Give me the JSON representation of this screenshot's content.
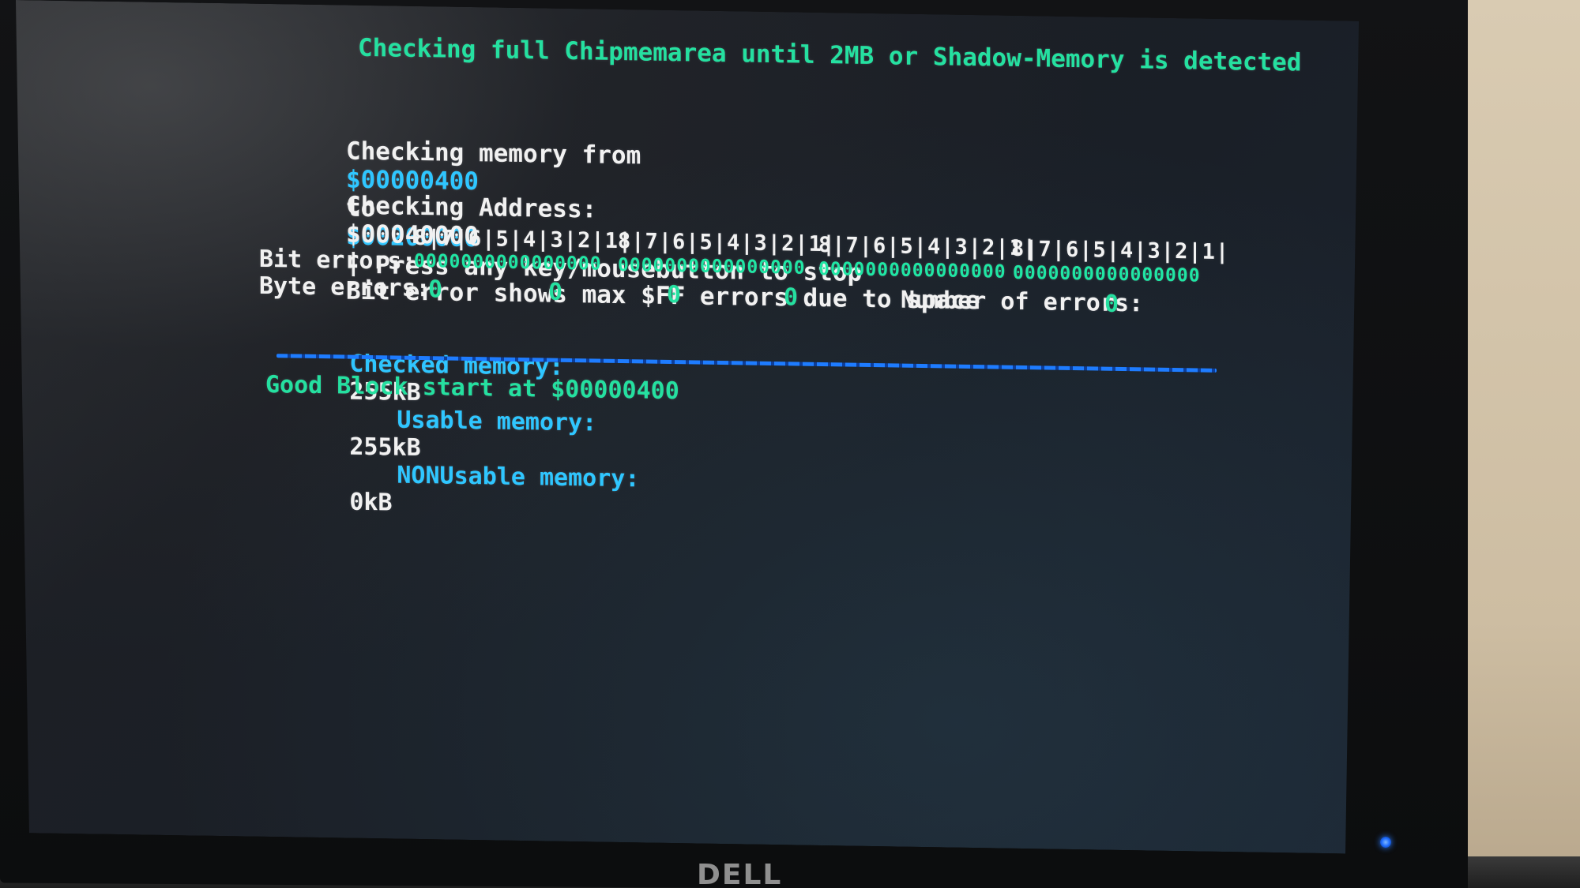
{
  "screen": {
    "title": "Checking full Chipmemarea until 2MB or Shadow-Memory is detected",
    "range_line": {
      "prefix": "Checking memory from",
      "from": "$00000400",
      "to_word": "to",
      "to": "$00200000",
      "suffix": "- Press any key/mousebutton to stop"
    },
    "address_line": {
      "label": "Checking Address:",
      "value": "$00040000",
      "separator": "|",
      "note": "Bit error shows max $FF errors due to space"
    },
    "bit_errors": {
      "column_labels": [
        "8|7|6|5|4|3|2|1|",
        "8|7|6|5|4|3|2|1|",
        "8|7|6|5|4|3|2|1|",
        "8|7|6|5|4|3|2|1|"
      ],
      "label": "Bit errors:",
      "groups": [
        "0000000000000000",
        "0000000000000000",
        "0000000000000000",
        "0000000000000000"
      ]
    },
    "byte_errors": {
      "label": "Byte errors:",
      "values": [
        "0",
        "0",
        "0",
        "0"
      ],
      "number_label": "Number of errors:",
      "number_value": "0"
    },
    "memory": {
      "checked_label": "Checked memory:",
      "checked_value": "255kB",
      "usable_label": "Usable memory:",
      "usable_value": "255kB",
      "nonusable_label": "NONUsable memory:",
      "nonusable_value": "0kB"
    },
    "good_block": "Good Block start at $00000400",
    "monitor_brand": "DELL"
  },
  "colors": {
    "green_text": "#25e0a0",
    "cyan_text": "#2fc6ff",
    "white_text": "#f1f1f1",
    "divider": "#1e7cff"
  }
}
